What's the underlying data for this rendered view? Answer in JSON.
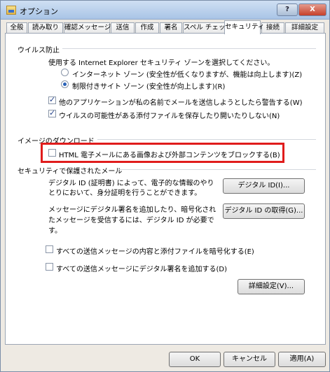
{
  "window": {
    "title": "オプション"
  },
  "titlebar": {
    "help": "?",
    "close": "X"
  },
  "tabs": [
    {
      "label": "全般"
    },
    {
      "label": "読み取り"
    },
    {
      "label": "確認メッセージ"
    },
    {
      "label": "送信"
    },
    {
      "label": "作成"
    },
    {
      "label": "署名"
    },
    {
      "label": "スペル チェック"
    },
    {
      "label": "セキュリティ"
    },
    {
      "label": "接続"
    },
    {
      "label": "詳細設定"
    }
  ],
  "virus": {
    "title": "ウイルス防止",
    "zone_prompt": "使用する Internet Explorer セキュリティ ゾーンを選択してください。",
    "radio_internet": "インターネット ゾーン (安全性が低くなりますが、機能は向上します)(Z)",
    "radio_restricted": "制限付きサイト ゾーン (安全性が向上します)(R)",
    "check_warn": "他のアプリケーションが私の名前でメールを送信しようとしたら警告する(W)",
    "check_attach": "ウイルスの可能性がある添付ファイルを保存したり開いたりしない(N)"
  },
  "images": {
    "title": "イメージのダウンロード",
    "check_block": "HTML 電子メールにある画像および外部コンテンツをブロックする(B)"
  },
  "secure": {
    "title": "セキュリティで保護されたメール",
    "desc1_line1": "デジタル ID (証明書) によって、電子的な情報のやり",
    "desc1_line2": "とりにおいて、身分証明を行うことができます。",
    "btn_digital_id": "デジタル ID(I)...",
    "desc2_line1": "メッセージにデジタル署名を追加したり、暗号化され",
    "desc2_line2": "たメッセージを受信するには、デジタル ID が必要で",
    "desc2_line3": "す。",
    "btn_get_id": "デジタル ID の取得(G)...",
    "check_encrypt": "すべての送信メッセージの内容と添付ファイルを暗号化する(E)",
    "check_sign": "すべての送信メッセージにデジタル署名を追加する(D)",
    "btn_advanced": "詳細設定(V)..."
  },
  "footer": {
    "ok": "OK",
    "cancel": "キャンセル",
    "apply": "適用(A)"
  }
}
